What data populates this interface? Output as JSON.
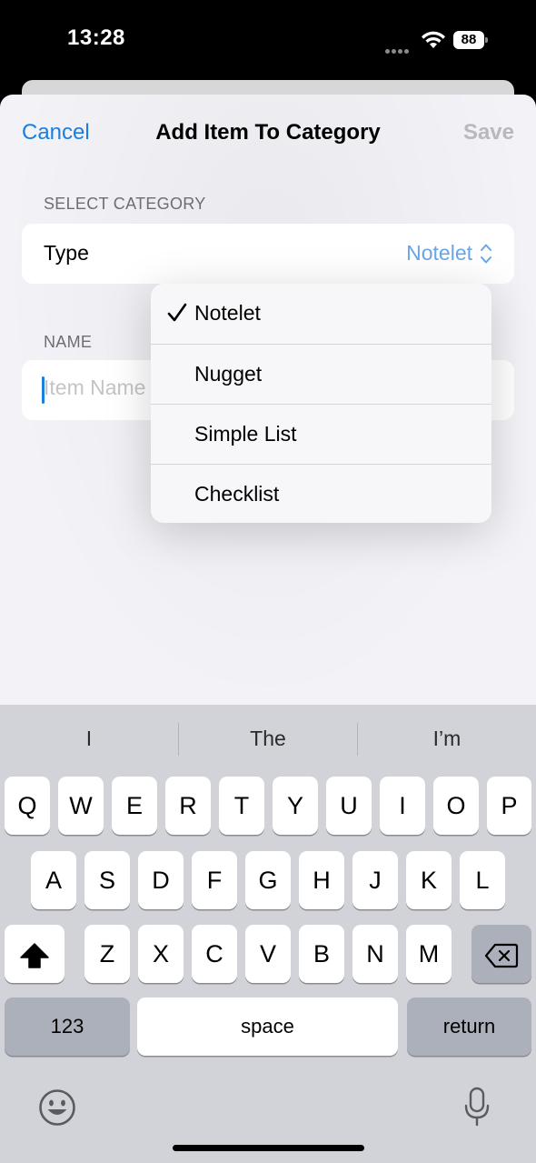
{
  "status_bar": {
    "time": "13:28",
    "battery_level": "88",
    "icons": [
      "signal-dots-icon",
      "wifi-icon",
      "battery-icon"
    ]
  },
  "nav": {
    "cancel_label": "Cancel",
    "title": "Add Item To Category",
    "save_label": "Save"
  },
  "category_section": {
    "header": "SELECT CATEGORY",
    "row_label": "Type",
    "selected_value": "Notelet"
  },
  "name_section": {
    "header": "NAME",
    "placeholder": "Item Name",
    "value": ""
  },
  "menu": {
    "items": [
      {
        "label": "Notelet",
        "checked": true
      },
      {
        "label": "Nugget",
        "checked": false
      },
      {
        "label": "Simple List",
        "checked": false
      },
      {
        "label": "Checklist",
        "checked": false
      }
    ]
  },
  "keyboard": {
    "suggestions": [
      "I",
      "The",
      "I’m"
    ],
    "row1": [
      "Q",
      "W",
      "E",
      "R",
      "T",
      "Y",
      "U",
      "I",
      "O",
      "P"
    ],
    "row2": [
      "A",
      "S",
      "D",
      "F",
      "G",
      "H",
      "J",
      "K",
      "L"
    ],
    "row3": [
      "Z",
      "X",
      "C",
      "V",
      "B",
      "N",
      "M"
    ],
    "numbers_label": "123",
    "space_label": "space",
    "return_label": "return"
  },
  "colors": {
    "accent": "#1a7ee0",
    "disabled": "#b8b8bd",
    "sheet_background": "#f2f2f7",
    "keyboard_background": "#d1d3d9"
  }
}
